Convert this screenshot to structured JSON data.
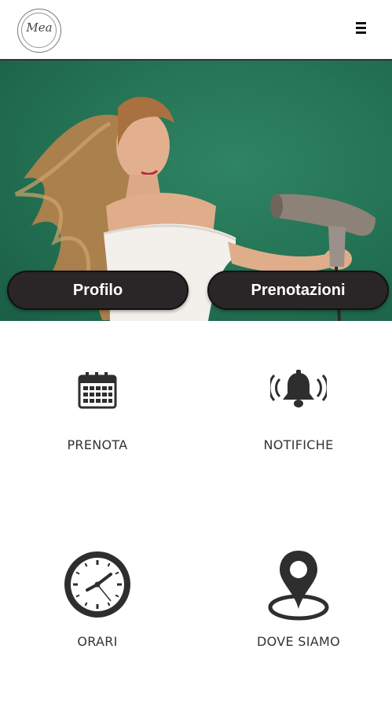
{
  "header": {
    "logo_text": "Mea",
    "menu_icon": "hamburger-icon"
  },
  "hero": {
    "buttons": [
      {
        "label": "Profilo"
      },
      {
        "label": "Prenotazioni"
      }
    ]
  },
  "menu": {
    "tiles": [
      {
        "label": "PRENOTA",
        "icon": "calendar-icon"
      },
      {
        "label": "NOTIFICHE",
        "icon": "bell-ringing-icon"
      },
      {
        "label": "ORARI",
        "icon": "clock-icon"
      },
      {
        "label": "DOVE SIAMO",
        "icon": "location-pin-icon"
      }
    ]
  },
  "colors": {
    "hero_bg": "#257556",
    "button_bg": "#2a2527",
    "icon": "#2e2e2e"
  }
}
